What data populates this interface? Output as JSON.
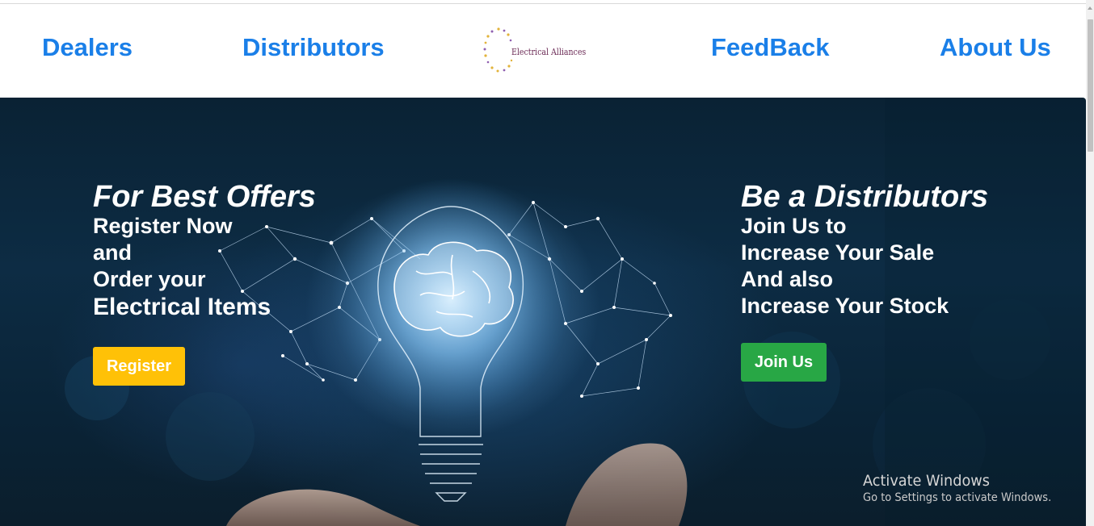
{
  "nav": {
    "dealers": "Dealers",
    "distributors": "Distributors",
    "feedback": "FeedBack",
    "about": "About Us",
    "logo_text": "Electrical Alliances"
  },
  "hero": {
    "offer": {
      "title": "For Best Offers",
      "line1": "Register Now",
      "line2": "and",
      "line3": "Order your",
      "line4": "Electrical Items",
      "button": "Register"
    },
    "distributor": {
      "title": "Be a Distributors",
      "line1": "Join Us to",
      "line2": "Increase Your Sale",
      "line3": "And also",
      "line4": "Increase Your Stock",
      "button": "Join Us"
    }
  },
  "watermark": {
    "title": "Activate Windows",
    "subtitle": "Go to Settings to activate Windows."
  },
  "colors": {
    "nav_link": "#1a7fe8",
    "register_button": "#ffc107",
    "join_button": "#28a745",
    "logo_text": "#6b2a55"
  }
}
